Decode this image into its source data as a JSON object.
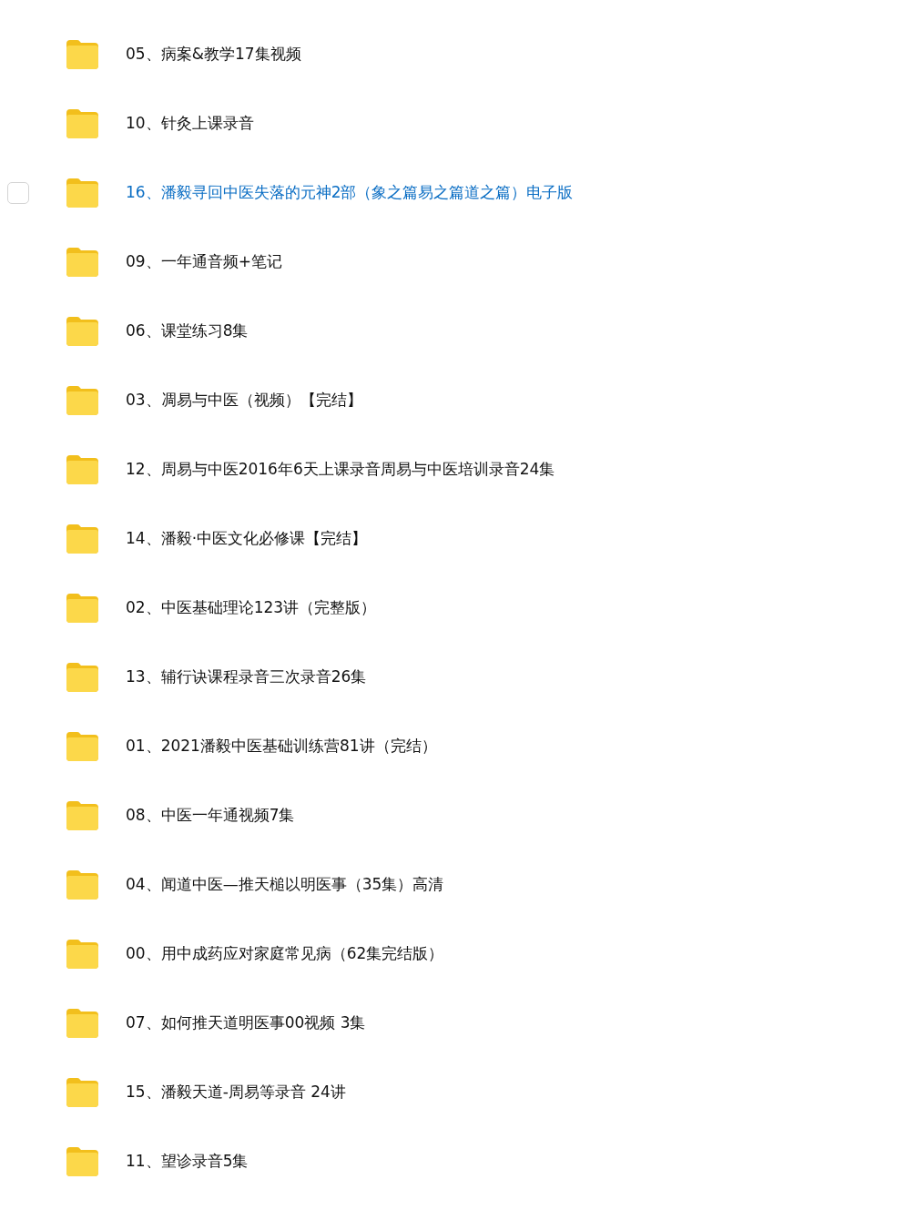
{
  "folders": [
    {
      "name": "05、病案&教学17集视频",
      "hovered": false,
      "checked": false
    },
    {
      "name": "10、针灸上课录音",
      "hovered": false,
      "checked": false
    },
    {
      "name": "16、潘毅寻回中医失落的元神2部（象之篇易之篇道之篇）电子版",
      "hovered": true,
      "checked": false
    },
    {
      "name": "09、一年通音频+笔记",
      "hovered": false,
      "checked": false
    },
    {
      "name": "06、课堂练习8集",
      "hovered": false,
      "checked": false
    },
    {
      "name": "03、凋易与中医（视频）【完结】",
      "hovered": false,
      "checked": false
    },
    {
      "name": "12、周易与中医2016年6天上课录音周易与中医培训录音24集",
      "hovered": false,
      "checked": false
    },
    {
      "name": "14、潘毅·中医文化必修课【完结】",
      "hovered": false,
      "checked": false
    },
    {
      "name": "02、中医基础理论123讲（完整版）",
      "hovered": false,
      "checked": false
    },
    {
      "name": "13、辅行诀课程录音三次录音26集",
      "hovered": false,
      "checked": false
    },
    {
      "name": "01、2021潘毅中医基础训练营81讲（完结）",
      "hovered": false,
      "checked": false
    },
    {
      "name": "08、中医一年通视频7集",
      "hovered": false,
      "checked": false
    },
    {
      "name": "04、闻道中医—推天槌以明医事（35集）高清",
      "hovered": false,
      "checked": false
    },
    {
      "name": "00、用中成药应对家庭常见病（62集完结版）",
      "hovered": false,
      "checked": false
    },
    {
      "name": "07、如何推天道明医事00视频 3集",
      "hovered": false,
      "checked": false
    },
    {
      "name": "15、潘毅天道-周易等录音 24讲",
      "hovered": false,
      "checked": false
    },
    {
      "name": "11、望诊录音5集",
      "hovered": false,
      "checked": false
    }
  ]
}
